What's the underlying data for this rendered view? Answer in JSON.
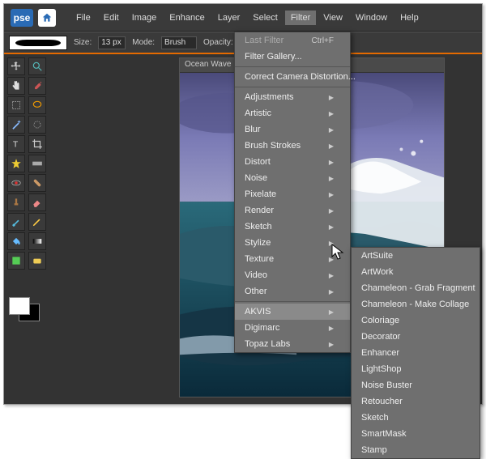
{
  "app": {
    "logo_text": "pse"
  },
  "menubar": [
    "File",
    "Edit",
    "Image",
    "Enhance",
    "Layer",
    "Select",
    "Filter",
    "View",
    "Window",
    "Help"
  ],
  "options": {
    "size_label": "Size:",
    "size_value": "13 px",
    "mode_label": "Mode:",
    "mode_value": "Brush",
    "opacity_label": "Opacity:"
  },
  "document": {
    "tab_title": "Ocean Wave"
  },
  "filter_menu": {
    "last_filter": "Last Filter",
    "last_filter_shortcut": "Ctrl+F",
    "filter_gallery": "Filter Gallery...",
    "correct_camera": "Correct Camera Distortion...",
    "groups": [
      "Adjustments",
      "Artistic",
      "Blur",
      "Brush Strokes",
      "Distort",
      "Noise",
      "Pixelate",
      "Render",
      "Sketch",
      "Stylize",
      "Texture",
      "Video",
      "Other"
    ],
    "plugins": [
      "AKVIS",
      "Digimarc",
      "Topaz Labs"
    ]
  },
  "akvis_submenu": [
    "ArtSuite",
    "ArtWork",
    "Chameleon - Grab Fragment",
    "Chameleon - Make Collage",
    "Coloriage",
    "Decorator",
    "Enhancer",
    "LightShop",
    "Noise Buster",
    "Retoucher",
    "Sketch",
    "SmartMask",
    "Stamp"
  ]
}
